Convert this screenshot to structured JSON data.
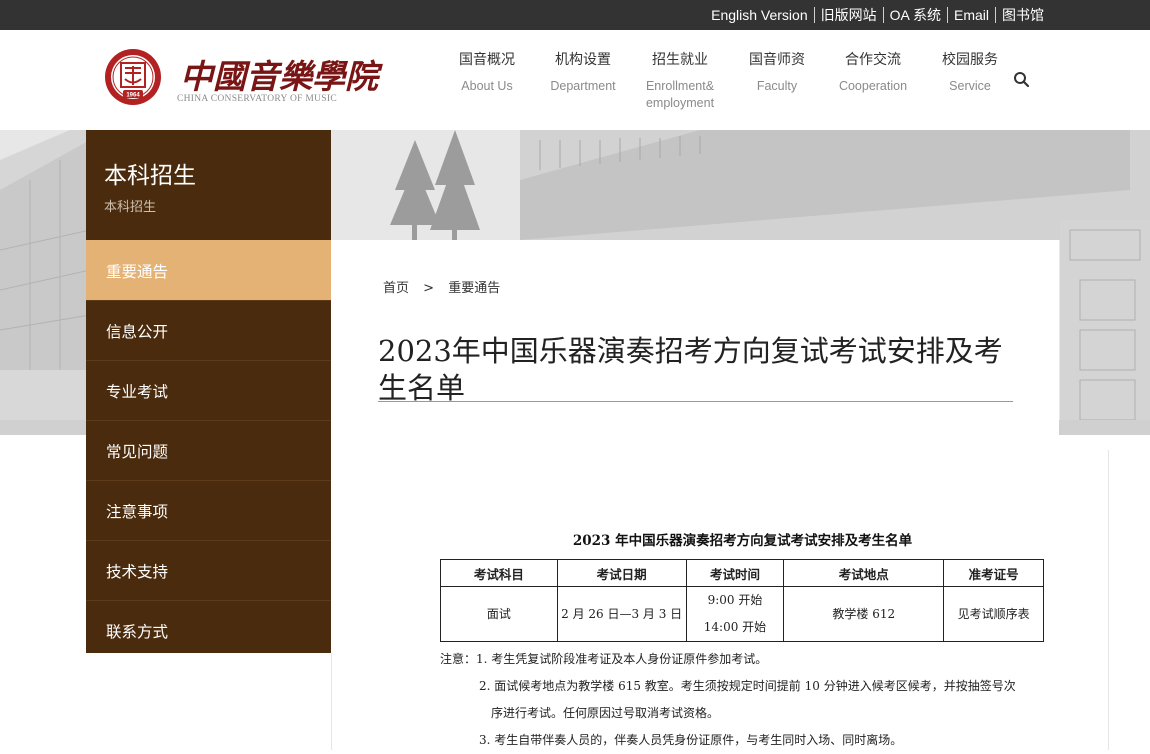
{
  "topbar": {
    "links": [
      "English Version",
      "旧版网站",
      "OA 系统",
      "Email",
      "图书馆"
    ]
  },
  "logo": {
    "name_cn": "中國音樂學院",
    "name_en": "CHINA CONSERVATORY OF MUSIC",
    "seal_year": "1964",
    "brand_color": "#8b1a1a"
  },
  "nav": [
    {
      "cn": "国音概况",
      "en": "About Us"
    },
    {
      "cn": "机构设置",
      "en": "Department"
    },
    {
      "cn": "招生就业",
      "en": "Enrollment& employment"
    },
    {
      "cn": "国音师资",
      "en": "Faculty"
    },
    {
      "cn": "合作交流",
      "en": "Cooperation"
    },
    {
      "cn": "校园服务",
      "en": "Service"
    }
  ],
  "search": {
    "icon": "search-icon"
  },
  "sidebar": {
    "title": "本科招生",
    "subtitle": "本科招生",
    "items": [
      {
        "label": "重要通告",
        "active": true
      },
      {
        "label": "信息公开",
        "active": false
      },
      {
        "label": "专业考试",
        "active": false
      },
      {
        "label": "常见问题",
        "active": false
      },
      {
        "label": "注意事项",
        "active": false
      },
      {
        "label": "技术支持",
        "active": false
      },
      {
        "label": "联系方式",
        "active": false
      }
    ],
    "bg_color": "#4b2b0d",
    "active_color": "#e5b276"
  },
  "breadcrumb": {
    "home": "首页",
    "sep": ">",
    "current": "重要通告"
  },
  "article": {
    "title": "2023年中国乐器演奏招考方向复试考试安排及考生名单",
    "doc_heading": "2023 年中国乐器演奏招考方向复试考试安排及考生名单",
    "table": {
      "headers": [
        "考试科目",
        "考试日期",
        "考试时间",
        "考试地点",
        "准考证号"
      ],
      "row": {
        "subject": "面试",
        "date": "2 月 26 日—3 月 3 日",
        "time1": "9:00 开始",
        "time2": "14:00 开始",
        "location": "教学楼 612",
        "ticket": "见考试顺序表"
      }
    },
    "notes": [
      "注意：1. 考生凭复试阶段准考证及本人身份证原件参加考试。",
      "2. 面试候考地点为教学楼 615 教室。考生须按规定时间提前 10 分钟进入候考区候考，并按抽签号次",
      "序进行考试。任何原因过号取消考试资格。",
      "3. 考生自带伴奏人员的，伴奏人员凭身份证原件，与考生同时入场、同时离场。"
    ]
  }
}
